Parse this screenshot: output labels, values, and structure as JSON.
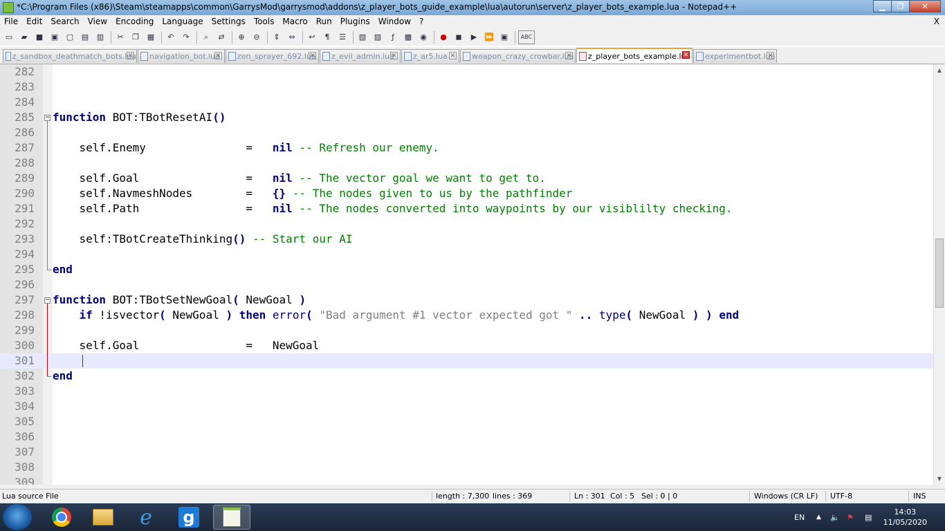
{
  "window": {
    "title": "*C:\\Program Files (x86)\\Steam\\steamapps\\common\\GarrysMod\\garrysmod\\addons\\z_player_bots_guide_example\\lua\\autorun\\server\\z_player_bots_example.lua - Notepad++",
    "minimize_label": "▁",
    "restore_label": "❐",
    "close_label": "✕"
  },
  "menubar": {
    "items": [
      "File",
      "Edit",
      "Search",
      "View",
      "Encoding",
      "Language",
      "Settings",
      "Tools",
      "Macro",
      "Run",
      "Plugins",
      "Window",
      "?"
    ],
    "close_doc": "X"
  },
  "toolbar": {
    "icons": [
      "new-file-icon",
      "open-file-icon",
      "save-icon",
      "save-all-icon",
      "close-icon",
      "close-all-icon",
      "print-icon",
      "cut-icon",
      "copy-icon",
      "paste-icon",
      "undo-icon",
      "redo-icon",
      "find-icon",
      "replace-icon",
      "zoom-in-icon",
      "zoom-out-icon",
      "sync-v-icon",
      "sync-h-icon",
      "word-wrap-icon",
      "show-all-chars-icon",
      "indent-guide-icon",
      "lang-define-icon",
      "doc-map-icon",
      "function-list-icon",
      "folder-as-workspace-icon",
      "monitoring-icon",
      "record-macro-icon",
      "stop-record-icon",
      "playback-icon",
      "run-macro-multiple-icon",
      "save-macro-icon",
      "spell-check-icon"
    ]
  },
  "tabs": [
    {
      "label": "z_sandbox_deathmatch_bots.lua",
      "active": false
    },
    {
      "label": "navigation_bot.lua",
      "active": false
    },
    {
      "label": "zen_sprayer_692.lua",
      "active": false
    },
    {
      "label": "z_evil_admin.lua",
      "active": false
    },
    {
      "label": "z_ar5.lua",
      "active": false
    },
    {
      "label": "weapon_crazy_crowbar.lua",
      "active": false
    },
    {
      "label": "z_player_bots_example.lua",
      "active": true
    },
    {
      "label": "experimentbot.lua",
      "active": false
    }
  ],
  "editor": {
    "line_numbers": [
      "282",
      "283",
      "284",
      "285",
      "286",
      "287",
      "288",
      "289",
      "290",
      "291",
      "292",
      "293",
      "294",
      "295",
      "296",
      "297",
      "298",
      "299",
      "300",
      "301",
      "302",
      "303",
      "304",
      "305",
      "306",
      "307",
      "308",
      "309"
    ],
    "current_line": "301",
    "code": {
      "l285": {
        "kw": "function",
        "name": " BOT:TBotResetAI",
        "paren": "()"
      },
      "l287": {
        "lhs": "    self.Enemy               =   ",
        "kw": "nil",
        "cm": " -- Refresh our enemy."
      },
      "l289": {
        "lhs": "    self.Goal                =   ",
        "kw": "nil",
        "cm": " -- The vector goal we want to get to."
      },
      "l290": {
        "lhs": "    self.NavmeshNodes        =   ",
        "kw": "{}",
        "cm": " -- The nodes given to us by the pathfinder"
      },
      "l291": {
        "lhs": "    self.Path                =   ",
        "kw": "nil",
        "cm": " -- The nodes converted into waypoints by our visiblilty checking."
      },
      "l293": {
        "lhs": "    self:TBotCreateThinking",
        "paren": "()",
        "cm": " -- Start our AI"
      },
      "l295": {
        "kw": "end"
      },
      "l297": {
        "kw": "function",
        "name": " BOT:TBotSetNewGoal",
        "p1": "(",
        "arg": " NewGoal ",
        "p2": ")"
      },
      "l298": {
        "indent": "    ",
        "kw_if": "if",
        "t1": " !isvector",
        "p1": "(",
        "t2": " NewGoal ",
        "p2": ")",
        "sp": " ",
        "kw_then": "then",
        "sp2": " ",
        "fn_error": "error",
        "p3": "(",
        "sp3": " ",
        "str": "\"Bad argument #1 vector expected got \"",
        "concat": " .. ",
        "fn_type": "type",
        "p4": "(",
        "t3": " NewGoal ",
        "p5": ")",
        "sp4": " ",
        "p6": ")",
        "sp5": " ",
        "kw_end": "end"
      },
      "l300": {
        "lhs": "    self.Goal                =   NewGoal"
      },
      "l302": {
        "kw": "end"
      }
    }
  },
  "status": {
    "file_type": "Lua source File",
    "length": "length : 7,300",
    "lines": "lines : 369",
    "ln": "Ln : 301",
    "col": "Col : 5",
    "sel": "Sel : 0 | 0",
    "eol": "Windows (CR LF)",
    "encoding": "UTF-8",
    "mode": "INS"
  },
  "taskbar": {
    "language": "EN",
    "time": "14:03",
    "date": "11/05/2020",
    "apps": [
      "chrome-icon",
      "explorer-icon",
      "ie-icon",
      "garrysmod-icon",
      "notepadpp-icon"
    ]
  }
}
